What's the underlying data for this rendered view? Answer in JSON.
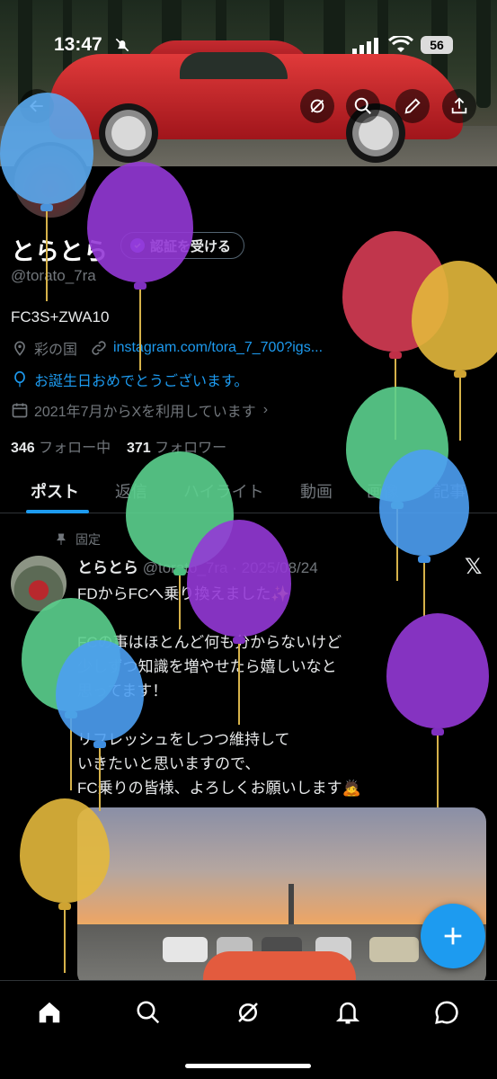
{
  "status_bar": {
    "time": "13:47",
    "battery": "56"
  },
  "profile": {
    "display_name": "とらとら",
    "verify_label": "認証を受ける",
    "handle": "@torato_7ra",
    "bio": "FC3S+ZWA10",
    "location": "彩の国",
    "link": "instagram.com/tora_7_700?igs...",
    "birthday": "お誕生日おめでとうございます。",
    "joined": "2021年7月からXを利用しています",
    "following_count": "346",
    "following_label": "フォロー中",
    "followers_count": "371",
    "followers_label": "フォロワー"
  },
  "tabs": [
    {
      "label": "ポスト"
    },
    {
      "label": "返信"
    },
    {
      "label": "ハイライト"
    },
    {
      "label": "動画"
    },
    {
      "label": "画像"
    },
    {
      "label": "記事"
    }
  ],
  "post": {
    "pinned_label": "固定",
    "author_name": "とらとら",
    "author_handle": "@torato_7ra",
    "date": "2025/08/24",
    "text": "FDからFCへ乗り換えました✨\n\nFCの事はほとんど何も分からないけど\n少しずつ知識を増やせたら嬉しいなと\n思ってます！\n\nリフレッシュをしつつ維持して\nいきたいと思いますので、\nFC乗りの皆様、よろしくお願いします🙇"
  },
  "icons": [
    "bell-off-icon",
    "signal-icon",
    "wifi-icon",
    "grok-icon",
    "search-icon",
    "edit-icon",
    "share-icon",
    "location-icon",
    "link-icon",
    "balloon-icon",
    "calendar-icon",
    "pin-icon",
    "x-logo-icon",
    "plus-icon",
    "home-icon",
    "bell-icon",
    "message-icon"
  ],
  "colors": {
    "accent": "#1d9bf0",
    "background": "#000000",
    "muted": "#71767b"
  }
}
